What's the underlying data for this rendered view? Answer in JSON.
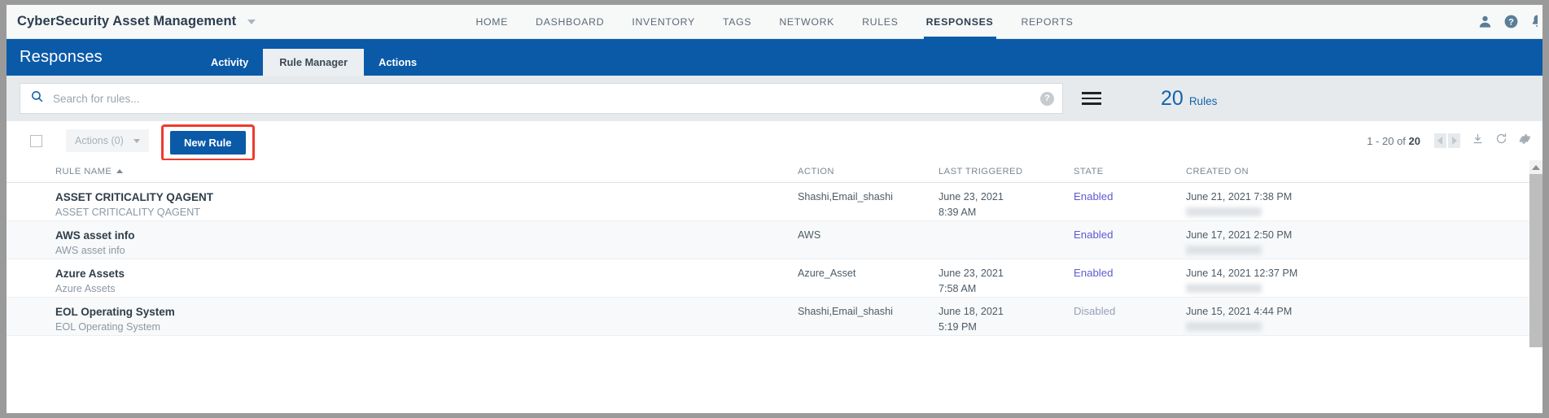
{
  "app": {
    "brand_title": "CyberSecurity Asset Management"
  },
  "topnav": {
    "items": [
      {
        "label": "HOME",
        "active": false
      },
      {
        "label": "DASHBOARD",
        "active": false
      },
      {
        "label": "INVENTORY",
        "active": false
      },
      {
        "label": "TAGS",
        "active": false
      },
      {
        "label": "NETWORK",
        "active": false
      },
      {
        "label": "RULES",
        "active": false
      },
      {
        "label": "RESPONSES",
        "active": true
      },
      {
        "label": "REPORTS",
        "active": false
      }
    ],
    "icons": [
      "user-icon",
      "help-icon",
      "notifications-icon"
    ]
  },
  "pagehead": {
    "title": "Responses",
    "tabs": [
      {
        "label": "Activity",
        "active": false
      },
      {
        "label": "Rule Manager",
        "active": true
      },
      {
        "label": "Actions",
        "active": false
      }
    ]
  },
  "search": {
    "placeholder": "Search for rules...",
    "value": "",
    "help_label": "?",
    "menu_icon": "hamburger-icon",
    "count": "20",
    "count_label": "Rules"
  },
  "toolbar": {
    "select_all_checked": false,
    "actions_label": "Actions (0)",
    "new_rule_label": "New Rule",
    "pager_range": "1 - 20 of ",
    "pager_total": "20",
    "icons": [
      "prev-page-icon",
      "next-page-icon",
      "download-icon",
      "refresh-icon",
      "settings-icon"
    ]
  },
  "table": {
    "columns": [
      {
        "key": "name",
        "label": "RULE NAME",
        "sorted": true
      },
      {
        "key": "action",
        "label": "ACTION",
        "sorted": false
      },
      {
        "key": "last_triggered",
        "label": "LAST TRIGGERED",
        "sorted": false
      },
      {
        "key": "state",
        "label": "STATE",
        "sorted": false
      },
      {
        "key": "created_on",
        "label": "CREATED ON",
        "sorted": false
      }
    ],
    "rows": [
      {
        "name": "ASSET CRITICALITY QAGENT",
        "sub": "ASSET CRITICALITY QAGENT",
        "action": "Shashi,Email_shashi",
        "triggered_date": "June 23, 2021",
        "triggered_time": "8:39 AM",
        "state": "Enabled",
        "created_on": "June 21, 2021 7:38 PM"
      },
      {
        "name": "AWS asset info",
        "sub": "AWS asset info",
        "action": "AWS",
        "triggered_date": "",
        "triggered_time": "",
        "state": "Enabled",
        "created_on": "June 17, 2021 2:50 PM"
      },
      {
        "name": "Azure Assets",
        "sub": "Azure Assets",
        "action": "Azure_Asset",
        "triggered_date": "June 23, 2021",
        "triggered_time": "7:58 AM",
        "state": "Enabled",
        "created_on": "June 14, 2021 12:37 PM"
      },
      {
        "name": "EOL Operating System",
        "sub": "EOL Operating System",
        "action": "Shashi,Email_shashi",
        "triggered_date": "June 18, 2021",
        "triggered_time": "5:19 PM",
        "state": "Disabled",
        "created_on": "June 15, 2021 4:44 PM"
      }
    ]
  },
  "colors": {
    "brand_blue": "#0b5aa8",
    "highlight_red": "#ef3b2d",
    "state_enabled": "#5f5ad1",
    "state_disabled": "#9aa0bb",
    "count_blue": "#1463ad"
  }
}
